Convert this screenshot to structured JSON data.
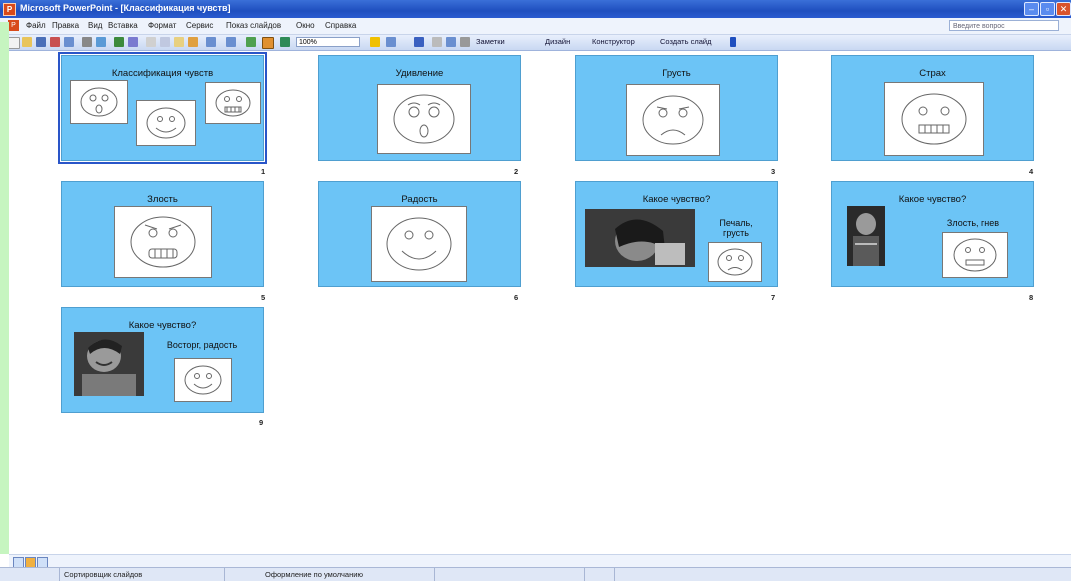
{
  "window": {
    "title": "Microsoft PowerPoint - [Классификация чувств]",
    "controls": [
      "–",
      "▫",
      "✕"
    ]
  },
  "menubar": {
    "items": [
      "Файл",
      "Правка",
      "Вид",
      "Вставка",
      "Формат",
      "Сервис",
      "Показ слайдов",
      "Окно",
      "Справка"
    ],
    "help_placeholder": "Введите вопрос"
  },
  "toolbar": {
    "zoom": "100%",
    "notes_label": "Заметки",
    "design_label": "Дизайн",
    "constructor_label": "Конструктор",
    "new_slide_label": "Создать слайд"
  },
  "slides": [
    {
      "number": "1",
      "title": "Классификация чувств",
      "captions": []
    },
    {
      "number": "2",
      "title": "Удивление",
      "captions": []
    },
    {
      "number": "3",
      "title": "Грусть",
      "captions": []
    },
    {
      "number": "4",
      "title": "Страх",
      "captions": []
    },
    {
      "number": "5",
      "title": "Злость",
      "captions": []
    },
    {
      "number": "6",
      "title": "Радость",
      "captions": []
    },
    {
      "number": "7",
      "title": "Какое чувство?",
      "captions": [
        "Печаль,",
        "грусть"
      ]
    },
    {
      "number": "8",
      "title": "Какое чувство?",
      "captions": [
        "Злость, гнев"
      ]
    },
    {
      "number": "9",
      "title": "Какое чувство?",
      "captions": [
        "Восторг, радость"
      ]
    }
  ],
  "status": {
    "view_mode": "Сортировщик слайдов",
    "design": "Оформление по умолчанию"
  },
  "colors": {
    "slide_bg": "#6cc4f6",
    "title_bar": "#1f4fbf"
  }
}
